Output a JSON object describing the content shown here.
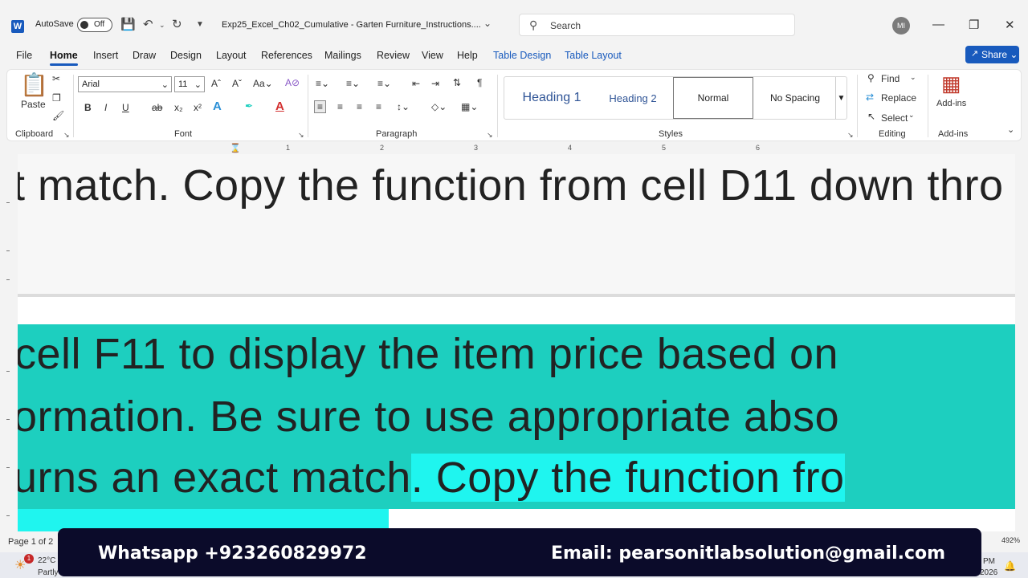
{
  "titlebar": {
    "app_icon": "W",
    "autosave_label": "AutoSave",
    "autosave_state": "Off",
    "doc_title": "Exp25_Excel_Ch02_Cumulative - Garten Furniture_Instructions....",
    "search_placeholder": "Search",
    "user_initials": "MI"
  },
  "menu": {
    "file": "File",
    "home": "Home",
    "insert": "Insert",
    "draw": "Draw",
    "design": "Design",
    "layout": "Layout",
    "references": "References",
    "mailings": "Mailings",
    "review": "Review",
    "view": "View",
    "help": "Help",
    "table_design": "Table Design",
    "table_layout": "Table Layout",
    "share": "Share"
  },
  "ribbon": {
    "clipboard": {
      "paste": "Paste",
      "label": "Clipboard"
    },
    "font": {
      "name": "Arial",
      "size": "11",
      "label": "Font"
    },
    "paragraph": {
      "label": "Paragraph"
    },
    "styles": {
      "heading1": "Heading 1",
      "heading2": "Heading 2",
      "normal": "Normal",
      "no_spacing": "No Spacing",
      "label": "Styles"
    },
    "editing": {
      "find": "Find",
      "replace": "Replace",
      "select": "Select",
      "label": "Editing"
    },
    "addins": {
      "button": "Add-ins",
      "label": "Add-ins"
    }
  },
  "ruler": {
    "numbers": [
      "1",
      "2",
      "3",
      "4",
      "5",
      "6"
    ]
  },
  "document": {
    "page1_line": "t match. Copy the function from cell D11 down thro",
    "line1": "cell F11 to display the item price based on",
    "line2": "ormation. Be sure to use appropriate abso",
    "line3a": "urns an exact match",
    "line3b": ". Copy the function fro"
  },
  "status": {
    "page": "Page 1 of 2",
    "zoom": "492%"
  },
  "taskbar": {
    "temp": "22°C",
    "weather": "Partly",
    "time": "PM",
    "date": "2026",
    "badge": "1"
  },
  "banner": {
    "whatsapp": "Whatsapp +923260829972",
    "email": "Email: pearsonitlabsolution@gmail.com"
  },
  "colors": {
    "accent": "#185abd",
    "highlight_teal": "#1dcfbf",
    "highlight_cyan": "#1ff5ef",
    "banner_bg": "#0b0b2a"
  }
}
